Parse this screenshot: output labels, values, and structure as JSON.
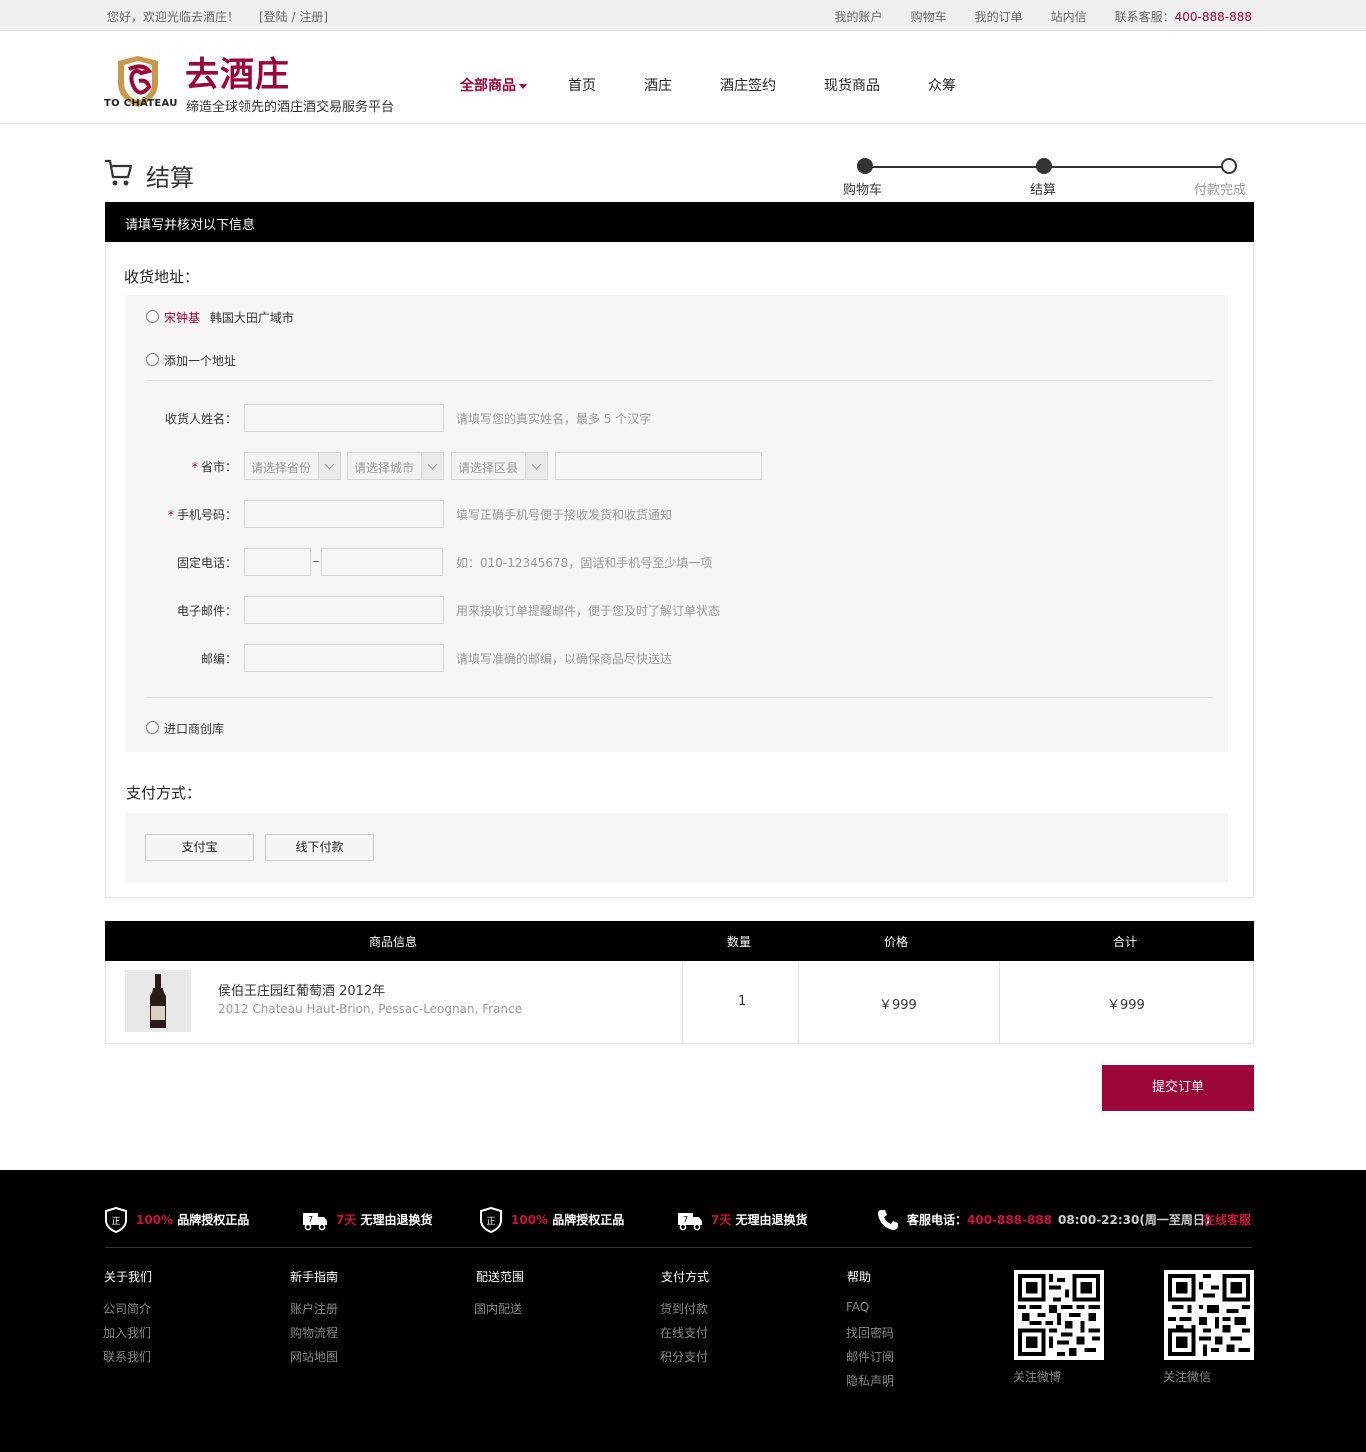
{
  "topbar": {
    "welcome": "您好，欢迎光临去酒庄！",
    "login": "[登陆 / 注册]",
    "links": [
      "我的账户",
      "购物车",
      "我的订单",
      "站内信"
    ],
    "service_label": "联系客服：",
    "service_phone": "400-888-888"
  },
  "header": {
    "logo_en": "TO CHÂTEAU",
    "logo_cn": "去酒庄",
    "slogan": "缔造全球领先的酒庄酒交易服务平台",
    "nav": [
      "全部商品",
      "首页",
      "酒庄",
      "酒庄签约",
      "现货商品",
      "众筹"
    ]
  },
  "page": {
    "title": "结算",
    "steps": [
      "购物车",
      "结算",
      "付款完成"
    ]
  },
  "form": {
    "panel_header": "请填写并核对以下信息",
    "address_title": "收货地址：",
    "saved_address_name": "宋钟基",
    "saved_address_text": "韩国大田广域市",
    "add_address": "添加一个地址",
    "warehouse": "进口商创库",
    "fields": {
      "name_label": "收货人姓名：",
      "name_hint": "请填写您的真实姓名，最多 5 个汉字",
      "region_label": "省市：",
      "province_placeholder": "请选择省份",
      "city_placeholder": "请选择城市",
      "district_placeholder": "请选择区县",
      "mobile_label": "手机号码：",
      "mobile_hint": "填写正确手机号便于接收发货和收货通知",
      "phone_label": "固定电话：",
      "phone_dash": "–",
      "phone_hint": "如：010-12345678，固话和手机号至少填一项",
      "email_label": "电子邮件：",
      "email_hint": "用来接收订单提醒邮件，便于您及时了解订单状态",
      "zip_label": "邮编：",
      "zip_hint": "请填写准确的邮编，以确保商品尽快送达",
      "required_mark": "*"
    },
    "payment_title": "支付方式：",
    "payment_options": [
      "支付宝",
      "线下付款"
    ]
  },
  "order": {
    "headers": [
      "商品信息",
      "数量",
      "价格",
      "合计"
    ],
    "items": [
      {
        "name_cn": "侯伯王庄园红葡萄酒 2012年",
        "name_en": "2012 Chateau Haut-Brion, Pessac-Leognan, France",
        "qty": "1",
        "price": "￥999",
        "total": "￥999"
      }
    ],
    "submit": "提交订单"
  },
  "footer": {
    "services": [
      {
        "highlight": "100%",
        "text": " 品牌授权正品",
        "icon": "shield-icon"
      },
      {
        "highlight": "7天",
        "text": " 无理由退换货",
        "icon": "truck-icon"
      },
      {
        "highlight": "100%",
        "text": " 品牌授权正品",
        "icon": "shield-icon"
      },
      {
        "highlight": "7天",
        "text": " 无理由退换货",
        "icon": "truck-icon"
      }
    ],
    "hotline_label": "客服电话：",
    "hotline_number": "400-888-888",
    "hours": "08:00-22:30(周一至周日)",
    "online_service": "在线客服",
    "columns": [
      {
        "title": "关于我们",
        "links": [
          "公司简介",
          "加入我们",
          "联系我们"
        ]
      },
      {
        "title": "新手指南",
        "links": [
          "账户注册",
          "购物流程",
          "网站地图"
        ]
      },
      {
        "title": "配送范围",
        "links": [
          "国内配送"
        ]
      },
      {
        "title": "支付方式",
        "links": [
          "货到付款",
          "在线支付",
          "积分支付"
        ]
      },
      {
        "title": "帮助",
        "links": [
          "FAQ",
          "找回密码",
          "邮件订阅",
          "隐私声明"
        ]
      }
    ],
    "qr_labels": [
      "关注微博",
      "关注微信"
    ]
  },
  "colors": {
    "brand": "#9b0537",
    "footer_red": "#c8133e"
  }
}
